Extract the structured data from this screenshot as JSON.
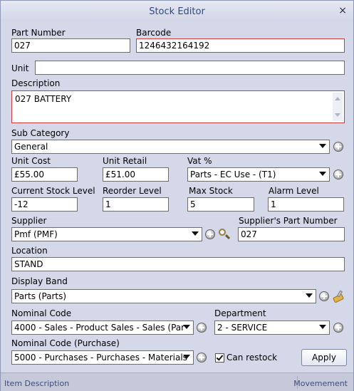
{
  "window": {
    "title": "Stock Editor",
    "close_glyph": "×"
  },
  "fields": {
    "part_number": {
      "label": "Part Number",
      "value": "027"
    },
    "barcode": {
      "label": "Barcode",
      "value": "1246432164192"
    },
    "unit": {
      "label": "Unit",
      "value": ""
    },
    "description": {
      "label": "Description",
      "value": "027 BATTERY"
    },
    "sub_category": {
      "label": "Sub Category",
      "value": "General"
    },
    "unit_cost": {
      "label": "Unit Cost",
      "value": "£55.00"
    },
    "unit_retail": {
      "label": "Unit Retail",
      "value": "£51.00"
    },
    "vat": {
      "label": "Vat %",
      "value": "Parts - EC Use - (T1)"
    },
    "current_stock": {
      "label": "Current Stock Level",
      "value": "-12"
    },
    "reorder_level": {
      "label": "Reorder Level",
      "value": "1"
    },
    "max_stock": {
      "label": "Max Stock",
      "value": "5"
    },
    "alarm_level": {
      "label": "Alarm Level",
      "value": "1"
    },
    "supplier": {
      "label": "Supplier",
      "value": "Pmf (PMF)"
    },
    "supplier_part_number": {
      "label": "Supplier's Part Number",
      "value": "027"
    },
    "location": {
      "label": "Location",
      "value": "STAND"
    },
    "display_band": {
      "label": "Display Band",
      "value": "Parts (Parts)"
    },
    "nominal_code": {
      "label": "Nominal Code",
      "value": "4000 - Sales - Product Sales - Sales (Par"
    },
    "department": {
      "label": "Department",
      "value": "2 - SERVICE"
    },
    "nominal_code_purchase": {
      "label": "Nominal Code (Purchase)",
      "value": "5000 - Purchases - Purchases - Materials"
    }
  },
  "can_restock": {
    "label": "Can restock",
    "checked": true
  },
  "apply_label": "Apply",
  "status_bar": {
    "left": "Item Description",
    "right": "Movemement"
  },
  "icons": [
    "close-icon",
    "dropdown-arrow-icon",
    "add-icon",
    "search-icon",
    "brush-icon",
    "checkmark-icon",
    "scroll-up-icon",
    "scroll-down-icon"
  ]
}
